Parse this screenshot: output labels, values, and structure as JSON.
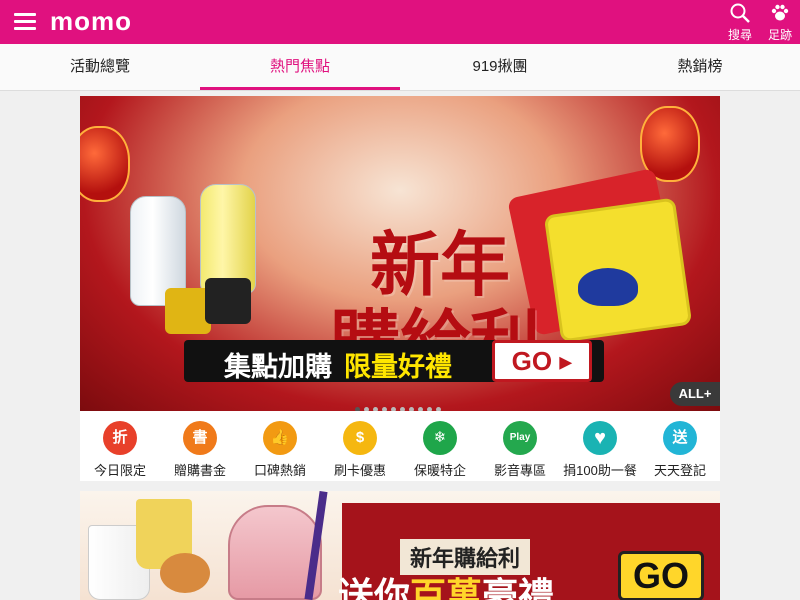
{
  "header": {
    "logo": "momo",
    "search_label": "搜尋",
    "footprint_label": "足跡",
    "colors": {
      "brand": "#e0117f"
    }
  },
  "tabs": [
    {
      "label": "活動總覽",
      "active": false
    },
    {
      "label": "熱門焦點",
      "active": true
    },
    {
      "label": "919揪團",
      "active": false
    },
    {
      "label": "熱銷榜",
      "active": false
    }
  ],
  "banner": {
    "headline_line1": "新年",
    "headline_line2": "購給利",
    "strip_text_white": "集點加購",
    "strip_text_yellow": "限量好禮",
    "go_label": "GO",
    "more_label": "ALL+",
    "pager": {
      "total": 10,
      "current": 1
    }
  },
  "categories": [
    {
      "label": "今日限定",
      "icon_glyph": "折",
      "icon": "discount-icon",
      "color": "#e8402a"
    },
    {
      "label": "贈購書金",
      "icon_glyph": "書",
      "icon": "book-icon",
      "color": "#f07a1a"
    },
    {
      "label": "口碑熱銷",
      "icon_glyph": "👍",
      "icon": "thumbs-up-icon",
      "color": "#f29a12"
    },
    {
      "label": "刷卡優惠",
      "icon_glyph": "$",
      "icon": "coin-icon",
      "color": "#f5b710"
    },
    {
      "label": "保暖特企",
      "icon_glyph": "❄",
      "icon": "snowflake-icon",
      "color": "#1fa64a"
    },
    {
      "label": "影音專區",
      "icon_glyph": "Play",
      "icon": "play-icon",
      "color": "#24a84e"
    },
    {
      "label": "捐100助一餐",
      "icon_glyph": "♥",
      "icon": "heart-icon",
      "color": "#1ab3b3"
    },
    {
      "label": "天天登記",
      "icon_glyph": "送",
      "icon": "gift-icon",
      "color": "#22b5d6"
    }
  ],
  "promo": {
    "title": "新年購給利",
    "subtitle_prefix": "送你",
    "subtitle_highlight": "百萬",
    "subtitle_suffix": "豪禮",
    "go_label": "GO"
  }
}
